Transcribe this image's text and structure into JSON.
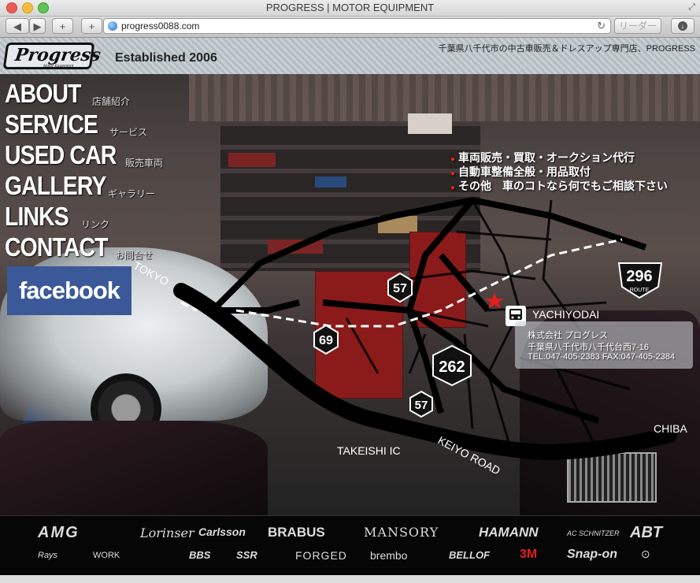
{
  "browser": {
    "window_title": "PROGRESS | MOTOR EQUIPMENT",
    "url": "progress0088.com",
    "reader_label": "リーダー",
    "back_glyph": "◀",
    "forward_glyph": "▶",
    "add_tab_glyph": "+",
    "add_bookmark_glyph": "+",
    "reload_glyph": "↻",
    "download_glyph": "↓",
    "fullscreen_glyph": "⤢"
  },
  "header": {
    "logo": "Progress",
    "logo_sub": "Motor Equipment",
    "established": "Established 2006",
    "tagline": "千葉県八千代市の中古車販売＆ドレスアップ専門店、PROGRESS"
  },
  "nav": [
    {
      "en": "ABOUT",
      "jp": "店舗紹介"
    },
    {
      "en": "SERVICE",
      "jp": "サービス"
    },
    {
      "en": "USED CAR",
      "jp": "販売車両"
    },
    {
      "en": "GALLERY",
      "jp": "ギャラリー"
    },
    {
      "en": "LINKS",
      "jp": "リンク"
    },
    {
      "en": "CONTACT",
      "jp": "お問合せ"
    }
  ],
  "facebook_label": "facebook",
  "features": [
    "車両販売・買取・オークション代行",
    "自動車整備全般・用品取付",
    "その他　車のコトなら何でもご相談下さい"
  ],
  "map": {
    "labels": {
      "tokyo": "TOKYO",
      "yachiyodai": "YACHIYODAI",
      "chiba": "CHIBA",
      "takeishi": "TAKEISHI IC",
      "keiyo": "KEIYO ROAD",
      "route": "ROUTE"
    },
    "route_numbers": {
      "r57a": "57",
      "r69": "69",
      "r262": "262",
      "r57b": "57",
      "r296": "296"
    }
  },
  "company": {
    "name": "株式会社 プログレス",
    "address": "千葉県八千代市八千代台西7-16",
    "contact": "TEL:047-405-2383 FAX:047-405-2384"
  },
  "brands_row1": [
    "AMG",
    "Lorinser",
    "Carlsson",
    "BRABUS",
    "MANSORY",
    "HAMANN",
    "AC SCHNITZER",
    "ABT"
  ],
  "brands_row2": [
    "Rays",
    "WORK",
    "BBS",
    "SSR",
    "FORGED",
    "brembo",
    "BELLOF",
    "3M",
    "Snap-on"
  ],
  "colors": {
    "facebook": "#3b5998",
    "route_shield": "#111111",
    "marker": "#e21e1e"
  }
}
